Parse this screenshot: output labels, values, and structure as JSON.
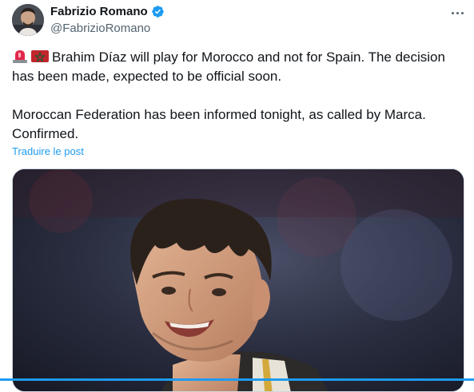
{
  "author": {
    "display_name": "Fabrizio Romano",
    "handle": "@FabrizioRomano",
    "verified": true
  },
  "tweet": {
    "lead_icons": [
      "rotating-light-icon",
      "morocco-flag-icon"
    ],
    "paragraph_1": "Brahim Díaz will play for Morocco and not for Spain. The decision has been made, expected to be official soon.",
    "paragraph_2": "Moroccan Federation has been informed tonight, as called by Marca. Confirmed.",
    "translate_label": "Traduire le post"
  },
  "media": {
    "icon": "player-photo"
  },
  "colors": {
    "accent": "#1d9bf0",
    "text": "#0f1419",
    "muted": "#536471",
    "verified_badge": "#1d9bf0",
    "morocco_red": "#c1272d",
    "morocco_green": "#006233"
  }
}
